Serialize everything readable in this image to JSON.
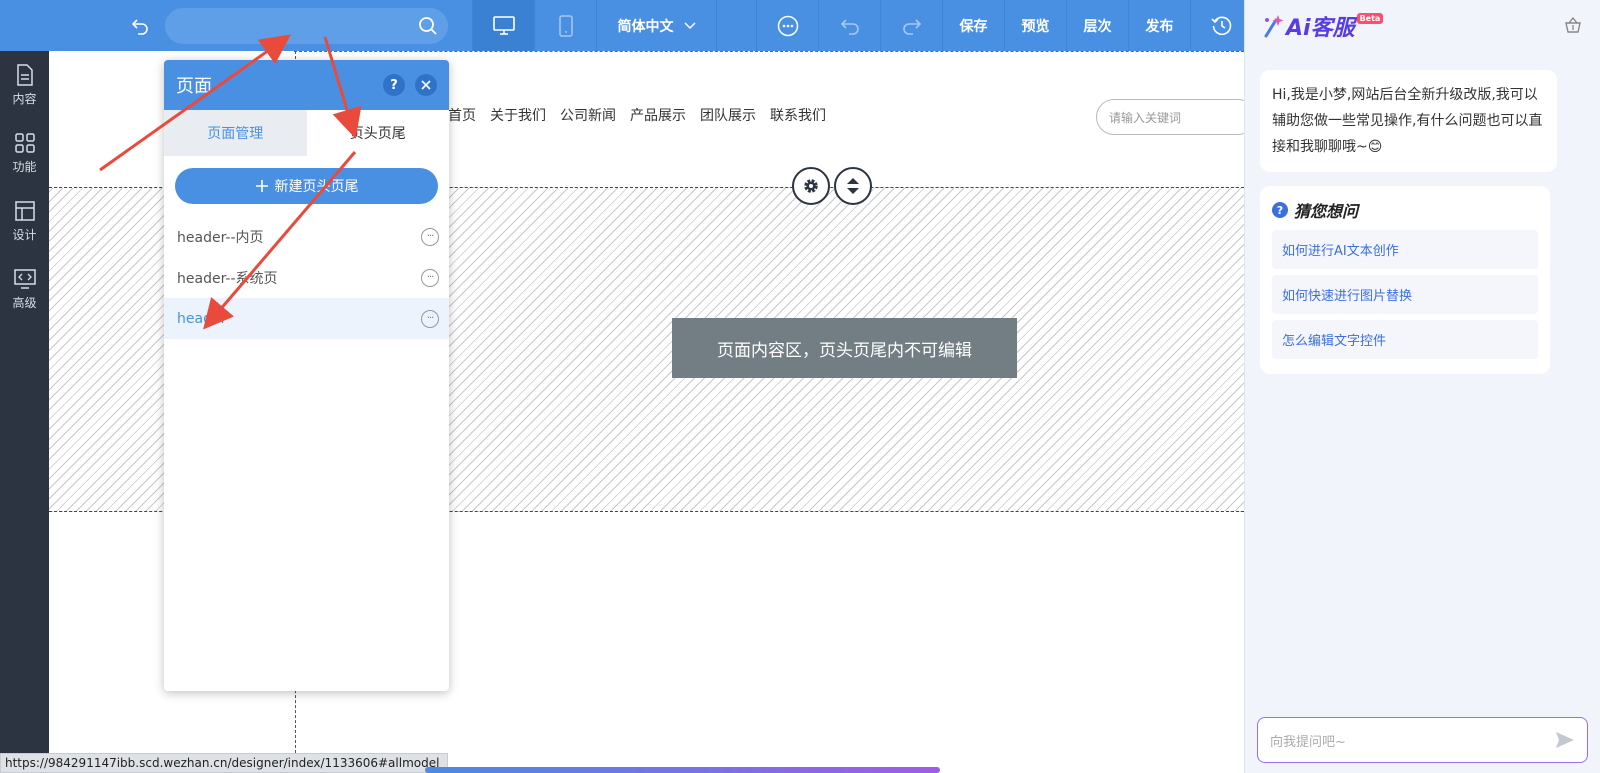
{
  "toolbar": {
    "search_placeholder": "",
    "language": "简体中文",
    "save": "保存",
    "preview": "预览",
    "layers": "层次",
    "publish": "发布"
  },
  "sidebar": {
    "items": [
      {
        "label": "内容",
        "icon": "document-icon"
      },
      {
        "label": "功能",
        "icon": "grid-icon"
      },
      {
        "label": "设计",
        "icon": "layout-icon"
      },
      {
        "label": "高级",
        "icon": "code-monitor-icon"
      }
    ]
  },
  "site": {
    "nav": [
      "首页",
      "关于我们",
      "公司新闻",
      "产品展示",
      "团队展示",
      "联系我们"
    ],
    "search_placeholder": "请输入关键词",
    "content_area_label": "页面内容区，页头页尾内不可编辑"
  },
  "panel": {
    "title": "页面",
    "help": "?",
    "tabs": [
      "页面管理",
      "页头页尾"
    ],
    "new_button": "新建页头页尾",
    "items": [
      {
        "label": "header--内页",
        "selected": false
      },
      {
        "label": "header--系统页",
        "selected": false
      },
      {
        "label": "header",
        "selected": true
      }
    ]
  },
  "ai": {
    "brand": "Ai客服",
    "badge": "Beta",
    "greeting": "Hi,我是小梦,网站后台全新升级改版,我可以辅助您做一些常见操作,有什么问题也可以直接和我聊聊哦~😊",
    "guess_title": "猜您想问",
    "questions": [
      "如何进行AI文本创作",
      "如何快速进行图片替换",
      "怎么编辑文字控件"
    ],
    "input_placeholder": "向我提问吧~"
  },
  "status": {
    "url": "https://984291147ibb.scd.wezhan.cn/designer/index/1133606#allmodel"
  },
  "colors": {
    "toolbar": "#4a90e2",
    "sidebar": "#2b3440",
    "accent": "#4a90e2",
    "annotation_arrow": "#e84b3c"
  }
}
